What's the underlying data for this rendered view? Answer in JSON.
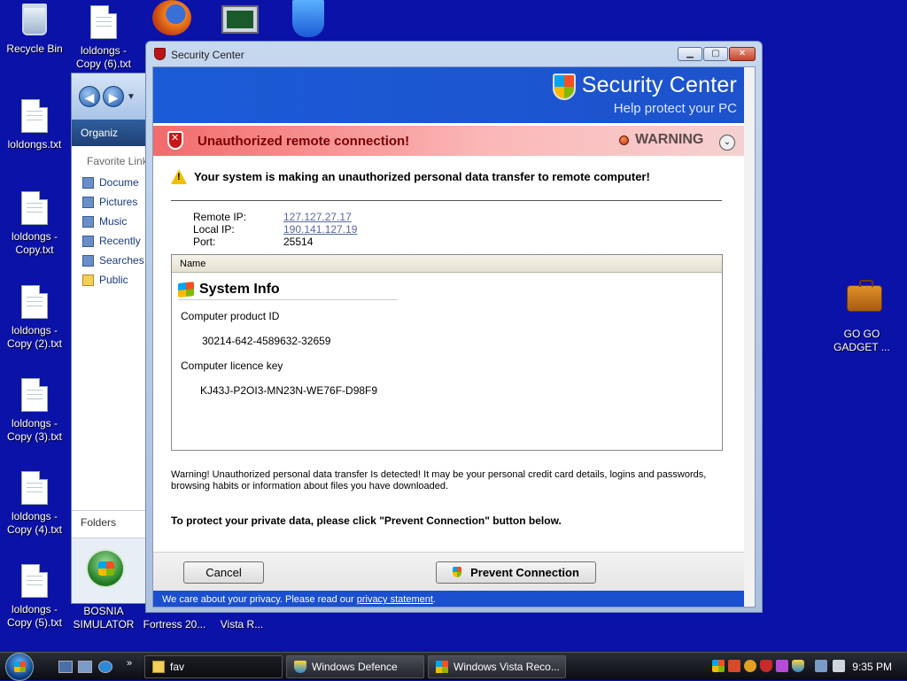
{
  "desktop": {
    "icons": [
      {
        "label": "Recycle Bin"
      },
      {
        "label": "loldongs - Copy (6).txt"
      },
      {
        "label": "loldongs.txt"
      },
      {
        "label": "loldongs - Copy.txt"
      },
      {
        "label": "loldongs - Copy (2).txt"
      },
      {
        "label": "loldongs - Copy (3).txt"
      },
      {
        "label": "loldongs - Copy (4).txt"
      },
      {
        "label": "loldongs - Copy (5).txt"
      },
      {
        "label": "GO GO GADGET ..."
      },
      {
        "label": "BOSNIA SIMULATOR"
      },
      {
        "label": "Fortress 20..."
      },
      {
        "label": "Vista R..."
      }
    ]
  },
  "explorer": {
    "organize": "Organiz",
    "favorite_links": "Favorite Link",
    "links": [
      "Docume",
      "Pictures",
      "Music",
      "Recently",
      "Searches",
      "Public"
    ],
    "folders": "Folders"
  },
  "window": {
    "title": "Security Center",
    "banner_title": "Security Center",
    "banner_subtitle": "Help protect your PC",
    "alert_title": "Unauthorized remote connection!",
    "alert_level": "WARNING",
    "message": "Your system is making an unauthorized personal data transfer to remote computer!",
    "connection": {
      "remote_ip_label": "Remote IP:",
      "remote_ip": "127.127.27.17",
      "local_ip_label": "Local IP:",
      "local_ip": "190.141.127.19",
      "port_label": "Port:",
      "port": "25514"
    },
    "table": {
      "column": "Name",
      "section_title": "System Info",
      "product_id_label": "Computer product ID",
      "product_id": "30214-642-4589632-32659",
      "licence_key_label": "Computer licence key",
      "licence_key": "KJ43J-P2OI3-MN23N-WE76F-D98F9"
    },
    "warning_paragraph": "Warning! Unauthorized personal data transfer Is detected! It may be your personal credit card details, logins and passwords, browsing habits or information about files you have downloaded.",
    "protect_text": "To protect your private data, please click \"Prevent Connection\" button below.",
    "cancel_button": "Cancel",
    "prevent_button": "Prevent Connection",
    "privacy_prefix": "We care about your privacy. Please read our ",
    "privacy_link": "privacy statement",
    "privacy_suffix": "."
  },
  "taskbar": {
    "tasks": [
      "fav",
      "Windows Defence",
      "Windows Vista Reco..."
    ],
    "clock": "9:35 PM"
  },
  "colors": {
    "desktop_bg": "#0b12a8",
    "banner_blue": "#1b5bd6",
    "alert_red": "#7a0000"
  }
}
